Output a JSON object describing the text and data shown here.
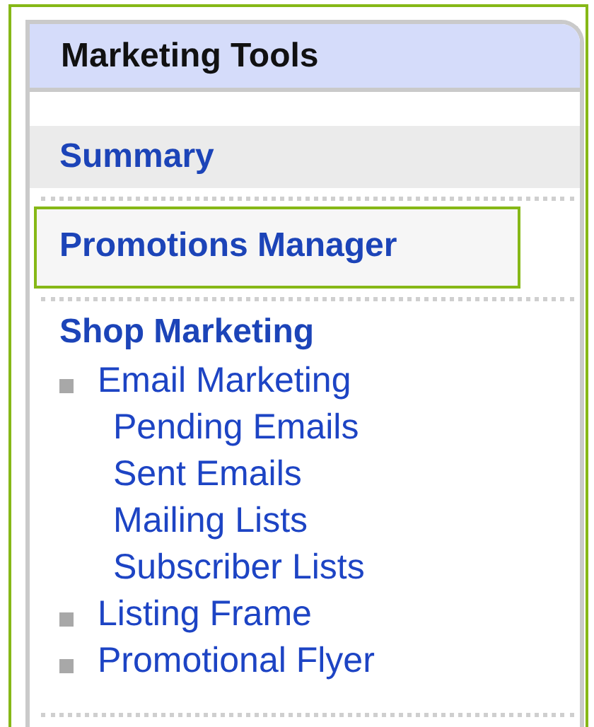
{
  "panel": {
    "title": "Marketing Tools"
  },
  "sections": [
    {
      "title": "Summary",
      "shaded": true,
      "highlighted": false
    },
    {
      "title": "Promotions Manager",
      "shaded": false,
      "highlighted": true
    },
    {
      "title": "Shop Marketing",
      "shaded": false,
      "highlighted": false,
      "items": [
        {
          "label": "Email Marketing",
          "children": [
            {
              "label": "Pending Emails"
            },
            {
              "label": "Sent Emails"
            },
            {
              "label": "Mailing Lists"
            },
            {
              "label": "Subscriber Lists"
            }
          ]
        },
        {
          "label": "Listing Frame"
        },
        {
          "label": "Promotional Flyer"
        }
      ]
    }
  ]
}
